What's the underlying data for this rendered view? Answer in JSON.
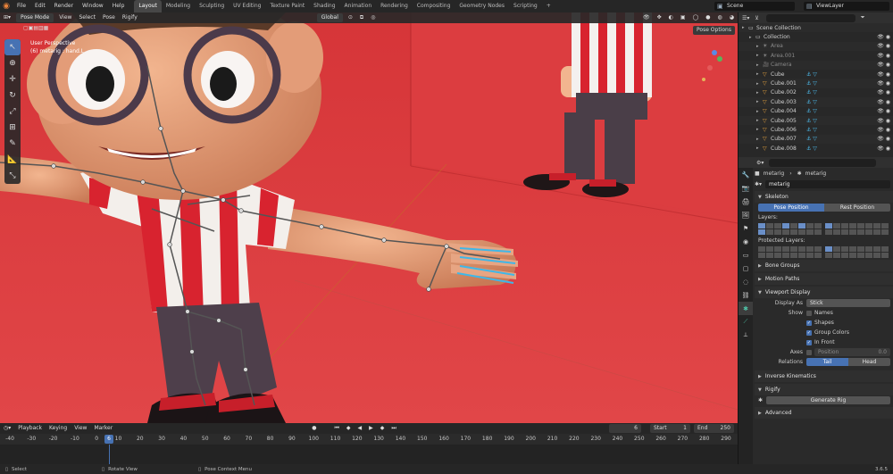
{
  "app": {
    "menus": [
      "File",
      "Edit",
      "Render",
      "Window",
      "Help"
    ],
    "workspaces": [
      "Layout",
      "Modeling",
      "Sculpting",
      "UV Editing",
      "Texture Paint",
      "Shading",
      "Animation",
      "Rendering",
      "Compositing",
      "Geometry Nodes",
      "Scripting"
    ],
    "active_workspace": "Layout",
    "add_workspace": "+",
    "scene": "Scene",
    "view_layer": "ViewLayer"
  },
  "viewport": {
    "mode": "Pose Mode",
    "menus": [
      "View",
      "Select",
      "Pose",
      "Rigify"
    ],
    "orientation": "Global",
    "view_label": "User Perspective",
    "object_label": "(6) metarig : hand.L",
    "pose_options": "Pose Options",
    "tools": [
      "cursor-select",
      "cursor",
      "move",
      "rotate",
      "scale",
      "transform",
      "annotate",
      "measure",
      "relax"
    ]
  },
  "timeline": {
    "menus": [
      "Playback",
      "Keying",
      "View",
      "Marker"
    ],
    "current_frame": "6",
    "start_label": "Start",
    "start": "1",
    "end_label": "End",
    "end": "250",
    "ticks": [
      "-40",
      "-30",
      "-20",
      "-10",
      "0",
      "10",
      "20",
      "30",
      "40",
      "50",
      "60",
      "70",
      "80",
      "90",
      "100",
      "110",
      "120",
      "130",
      "140",
      "150",
      "160",
      "170",
      "180",
      "190",
      "200",
      "210",
      "220",
      "230",
      "240",
      "250",
      "260",
      "270",
      "280",
      "290"
    ],
    "cursor_frame": "6"
  },
  "statusbar": {
    "select": "Select",
    "rotate": "Rotate View",
    "context": "Pose Context Menu",
    "version": "3.6.5"
  },
  "outliner": {
    "rows": [
      {
        "name": "Scene Collection",
        "icon": "collection-icon",
        "indent": 0
      },
      {
        "name": "Collection",
        "icon": "collection-icon",
        "indent": 1
      },
      {
        "name": "Area",
        "icon": "light-icon",
        "indent": 2
      },
      {
        "name": "Area.001",
        "icon": "light-icon",
        "indent": 2
      },
      {
        "name": "Camera",
        "icon": "camera-icon",
        "indent": 2
      },
      {
        "name": "Cube",
        "icon": "mesh-icon",
        "indent": 2
      },
      {
        "name": "Cube.001",
        "icon": "mesh-icon",
        "indent": 2
      },
      {
        "name": "Cube.002",
        "icon": "mesh-icon",
        "indent": 2
      },
      {
        "name": "Cube.003",
        "icon": "mesh-icon",
        "indent": 2
      },
      {
        "name": "Cube.004",
        "icon": "mesh-icon",
        "indent": 2
      },
      {
        "name": "Cube.005",
        "icon": "mesh-icon",
        "indent": 2
      },
      {
        "name": "Cube.006",
        "icon": "mesh-icon",
        "indent": 2
      },
      {
        "name": "Cube.007",
        "icon": "mesh-icon",
        "indent": 2
      },
      {
        "name": "Cube.008",
        "icon": "mesh-icon",
        "indent": 2
      }
    ]
  },
  "properties": {
    "breadcrumb_object": "metarig",
    "breadcrumb_data": "metarig",
    "datablock": "metarig",
    "skeleton": {
      "title": "Skeleton",
      "pose_position": "Pose Position",
      "rest_position": "Rest Position",
      "layers_label": "Layers:",
      "protected_label": "Protected Layers:"
    },
    "bone_groups": "Bone Groups",
    "motion_paths": "Motion Paths",
    "viewport_display": {
      "title": "Viewport Display",
      "display_as_label": "Display As",
      "display_as": "Stick",
      "show_label": "Show",
      "names": "Names",
      "shapes": "Shapes",
      "group_colors": "Group Colors",
      "in_front": "In Front",
      "axes_label": "Axes",
      "axes_position_label": "Position",
      "axes_position": "0.0",
      "relations_label": "Relations",
      "tail": "Tail",
      "head": "Head"
    },
    "inverse_kinematics": "Inverse Kinematics",
    "rigify": "Rigify",
    "generate_rig": "Generate Rig",
    "advanced": "Advanced"
  },
  "colors": {
    "accent": "#4772b3",
    "floor": "#d9373a",
    "skin": "#e9a07e",
    "stripe_red": "#d8232f",
    "bone": "#3fb7e8"
  }
}
